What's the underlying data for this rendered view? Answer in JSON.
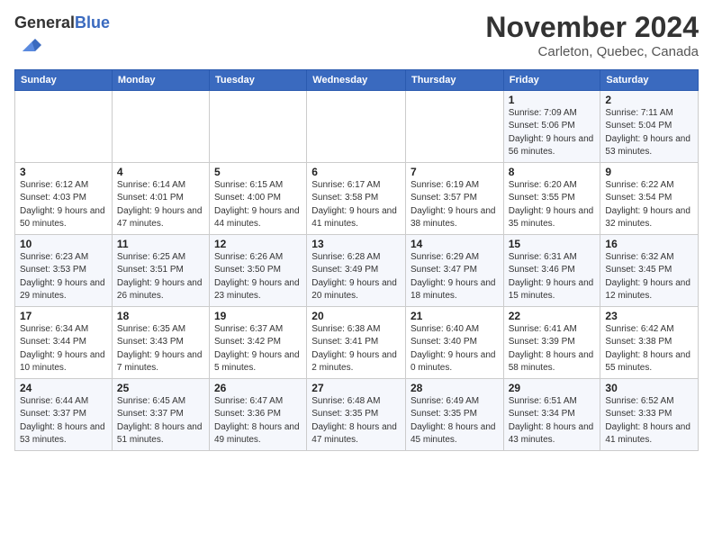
{
  "logo": {
    "general": "General",
    "blue": "Blue"
  },
  "title": "November 2024",
  "subtitle": "Carleton, Quebec, Canada",
  "days_of_week": [
    "Sunday",
    "Monday",
    "Tuesday",
    "Wednesday",
    "Thursday",
    "Friday",
    "Saturday"
  ],
  "weeks": [
    [
      {
        "day": "",
        "detail": ""
      },
      {
        "day": "",
        "detail": ""
      },
      {
        "day": "",
        "detail": ""
      },
      {
        "day": "",
        "detail": ""
      },
      {
        "day": "",
        "detail": ""
      },
      {
        "day": "1",
        "detail": "Sunrise: 7:09 AM\nSunset: 5:06 PM\nDaylight: 9 hours and 56 minutes."
      },
      {
        "day": "2",
        "detail": "Sunrise: 7:11 AM\nSunset: 5:04 PM\nDaylight: 9 hours and 53 minutes."
      }
    ],
    [
      {
        "day": "3",
        "detail": "Sunrise: 6:12 AM\nSunset: 4:03 PM\nDaylight: 9 hours and 50 minutes."
      },
      {
        "day": "4",
        "detail": "Sunrise: 6:14 AM\nSunset: 4:01 PM\nDaylight: 9 hours and 47 minutes."
      },
      {
        "day": "5",
        "detail": "Sunrise: 6:15 AM\nSunset: 4:00 PM\nDaylight: 9 hours and 44 minutes."
      },
      {
        "day": "6",
        "detail": "Sunrise: 6:17 AM\nSunset: 3:58 PM\nDaylight: 9 hours and 41 minutes."
      },
      {
        "day": "7",
        "detail": "Sunrise: 6:19 AM\nSunset: 3:57 PM\nDaylight: 9 hours and 38 minutes."
      },
      {
        "day": "8",
        "detail": "Sunrise: 6:20 AM\nSunset: 3:55 PM\nDaylight: 9 hours and 35 minutes."
      },
      {
        "day": "9",
        "detail": "Sunrise: 6:22 AM\nSunset: 3:54 PM\nDaylight: 9 hours and 32 minutes."
      }
    ],
    [
      {
        "day": "10",
        "detail": "Sunrise: 6:23 AM\nSunset: 3:53 PM\nDaylight: 9 hours and 29 minutes."
      },
      {
        "day": "11",
        "detail": "Sunrise: 6:25 AM\nSunset: 3:51 PM\nDaylight: 9 hours and 26 minutes."
      },
      {
        "day": "12",
        "detail": "Sunrise: 6:26 AM\nSunset: 3:50 PM\nDaylight: 9 hours and 23 minutes."
      },
      {
        "day": "13",
        "detail": "Sunrise: 6:28 AM\nSunset: 3:49 PM\nDaylight: 9 hours and 20 minutes."
      },
      {
        "day": "14",
        "detail": "Sunrise: 6:29 AM\nSunset: 3:47 PM\nDaylight: 9 hours and 18 minutes."
      },
      {
        "day": "15",
        "detail": "Sunrise: 6:31 AM\nSunset: 3:46 PM\nDaylight: 9 hours and 15 minutes."
      },
      {
        "day": "16",
        "detail": "Sunrise: 6:32 AM\nSunset: 3:45 PM\nDaylight: 9 hours and 12 minutes."
      }
    ],
    [
      {
        "day": "17",
        "detail": "Sunrise: 6:34 AM\nSunset: 3:44 PM\nDaylight: 9 hours and 10 minutes."
      },
      {
        "day": "18",
        "detail": "Sunrise: 6:35 AM\nSunset: 3:43 PM\nDaylight: 9 hours and 7 minutes."
      },
      {
        "day": "19",
        "detail": "Sunrise: 6:37 AM\nSunset: 3:42 PM\nDaylight: 9 hours and 5 minutes."
      },
      {
        "day": "20",
        "detail": "Sunrise: 6:38 AM\nSunset: 3:41 PM\nDaylight: 9 hours and 2 minutes."
      },
      {
        "day": "21",
        "detail": "Sunrise: 6:40 AM\nSunset: 3:40 PM\nDaylight: 9 hours and 0 minutes."
      },
      {
        "day": "22",
        "detail": "Sunrise: 6:41 AM\nSunset: 3:39 PM\nDaylight: 8 hours and 58 minutes."
      },
      {
        "day": "23",
        "detail": "Sunrise: 6:42 AM\nSunset: 3:38 PM\nDaylight: 8 hours and 55 minutes."
      }
    ],
    [
      {
        "day": "24",
        "detail": "Sunrise: 6:44 AM\nSunset: 3:37 PM\nDaylight: 8 hours and 53 minutes."
      },
      {
        "day": "25",
        "detail": "Sunrise: 6:45 AM\nSunset: 3:37 PM\nDaylight: 8 hours and 51 minutes."
      },
      {
        "day": "26",
        "detail": "Sunrise: 6:47 AM\nSunset: 3:36 PM\nDaylight: 8 hours and 49 minutes."
      },
      {
        "day": "27",
        "detail": "Sunrise: 6:48 AM\nSunset: 3:35 PM\nDaylight: 8 hours and 47 minutes."
      },
      {
        "day": "28",
        "detail": "Sunrise: 6:49 AM\nSunset: 3:35 PM\nDaylight: 8 hours and 45 minutes."
      },
      {
        "day": "29",
        "detail": "Sunrise: 6:51 AM\nSunset: 3:34 PM\nDaylight: 8 hours and 43 minutes."
      },
      {
        "day": "30",
        "detail": "Sunrise: 6:52 AM\nSunset: 3:33 PM\nDaylight: 8 hours and 41 minutes."
      }
    ]
  ]
}
